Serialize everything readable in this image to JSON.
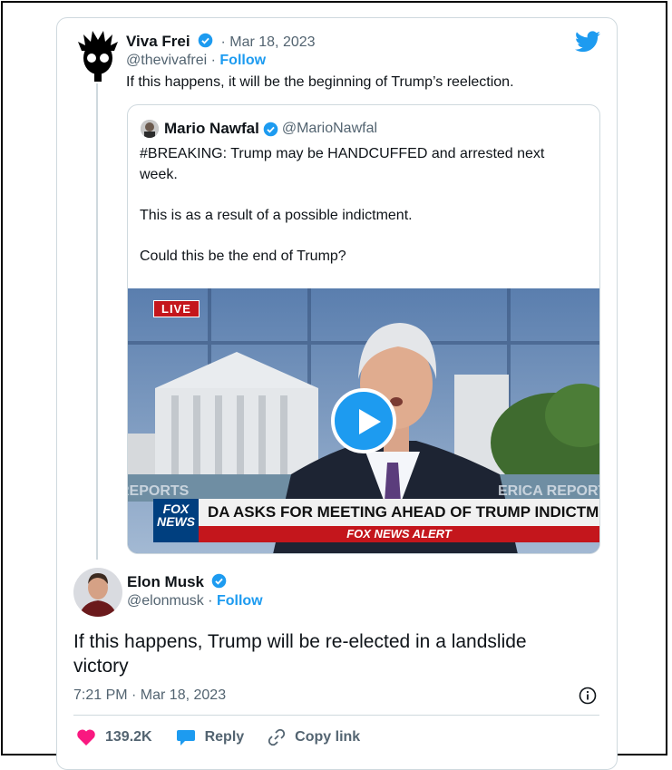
{
  "tweet": {
    "author_name": "Viva Frei",
    "author_handle": "@thevivafrei",
    "date": "· Mar 18, 2023",
    "follow_label": "Follow",
    "text": "If this happens, it will be the beginning of Trump’s reelection."
  },
  "quoted": {
    "author_name": "Mario Nawfal",
    "author_handle": "@MarioNawfal",
    "paragraphs": [
      "#BREAKING: Trump may be HANDCUFFED and arrested next week.",
      "This is as a result of a possible indictment.",
      "Could this be the end of Trump?"
    ],
    "video": {
      "live_label": "LIVE",
      "logo_text": "FOX NEWS",
      "headline": "DA ASKS FOR MEETING AHEAD OF TRUMP INDICTMENT",
      "subline": "FOX NEWS ALERT"
    }
  },
  "reply": {
    "author_name": "Elon Musk",
    "author_handle": "@elonmusk",
    "follow_label": "Follow",
    "text": "If this happens, Trump will be re-elected in a landslide victory",
    "timestamp": "7:21 PM · Mar 18, 2023"
  },
  "actions": {
    "likes": "139.2K",
    "reply_label": "Reply",
    "copy_label": "Copy link"
  },
  "colors": {
    "accent": "#1d9bf0",
    "like": "#f91880",
    "muted": "#536471",
    "border": "#cfd9de"
  }
}
